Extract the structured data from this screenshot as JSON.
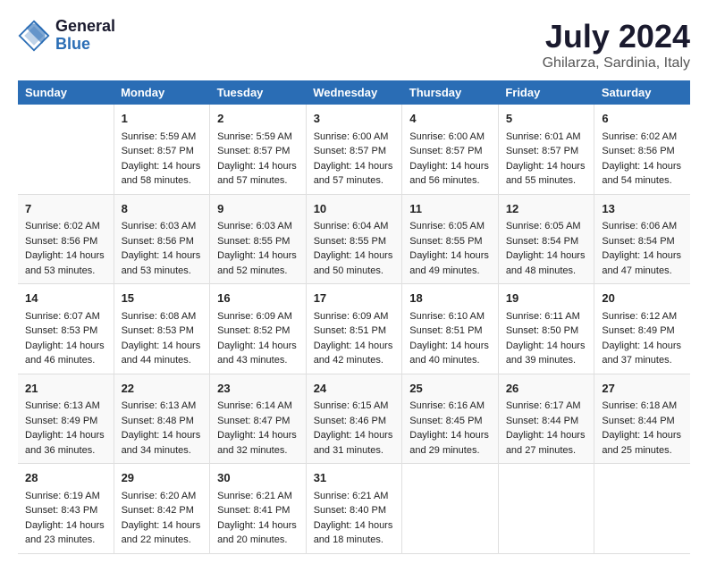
{
  "logo": {
    "general": "General",
    "blue": "Blue"
  },
  "title": "July 2024",
  "subtitle": "Ghilarza, Sardinia, Italy",
  "days_header": [
    "Sunday",
    "Monday",
    "Tuesday",
    "Wednesday",
    "Thursday",
    "Friday",
    "Saturday"
  ],
  "weeks": [
    [
      {
        "day": "",
        "info": ""
      },
      {
        "day": "1",
        "info": "Sunrise: 5:59 AM\nSunset: 8:57 PM\nDaylight: 14 hours\nand 58 minutes."
      },
      {
        "day": "2",
        "info": "Sunrise: 5:59 AM\nSunset: 8:57 PM\nDaylight: 14 hours\nand 57 minutes."
      },
      {
        "day": "3",
        "info": "Sunrise: 6:00 AM\nSunset: 8:57 PM\nDaylight: 14 hours\nand 57 minutes."
      },
      {
        "day": "4",
        "info": "Sunrise: 6:00 AM\nSunset: 8:57 PM\nDaylight: 14 hours\nand 56 minutes."
      },
      {
        "day": "5",
        "info": "Sunrise: 6:01 AM\nSunset: 8:57 PM\nDaylight: 14 hours\nand 55 minutes."
      },
      {
        "day": "6",
        "info": "Sunrise: 6:02 AM\nSunset: 8:56 PM\nDaylight: 14 hours\nand 54 minutes."
      }
    ],
    [
      {
        "day": "7",
        "info": "Sunrise: 6:02 AM\nSunset: 8:56 PM\nDaylight: 14 hours\nand 53 minutes."
      },
      {
        "day": "8",
        "info": "Sunrise: 6:03 AM\nSunset: 8:56 PM\nDaylight: 14 hours\nand 53 minutes."
      },
      {
        "day": "9",
        "info": "Sunrise: 6:03 AM\nSunset: 8:55 PM\nDaylight: 14 hours\nand 52 minutes."
      },
      {
        "day": "10",
        "info": "Sunrise: 6:04 AM\nSunset: 8:55 PM\nDaylight: 14 hours\nand 50 minutes."
      },
      {
        "day": "11",
        "info": "Sunrise: 6:05 AM\nSunset: 8:55 PM\nDaylight: 14 hours\nand 49 minutes."
      },
      {
        "day": "12",
        "info": "Sunrise: 6:05 AM\nSunset: 8:54 PM\nDaylight: 14 hours\nand 48 minutes."
      },
      {
        "day": "13",
        "info": "Sunrise: 6:06 AM\nSunset: 8:54 PM\nDaylight: 14 hours\nand 47 minutes."
      }
    ],
    [
      {
        "day": "14",
        "info": "Sunrise: 6:07 AM\nSunset: 8:53 PM\nDaylight: 14 hours\nand 46 minutes."
      },
      {
        "day": "15",
        "info": "Sunrise: 6:08 AM\nSunset: 8:53 PM\nDaylight: 14 hours\nand 44 minutes."
      },
      {
        "day": "16",
        "info": "Sunrise: 6:09 AM\nSunset: 8:52 PM\nDaylight: 14 hours\nand 43 minutes."
      },
      {
        "day": "17",
        "info": "Sunrise: 6:09 AM\nSunset: 8:51 PM\nDaylight: 14 hours\nand 42 minutes."
      },
      {
        "day": "18",
        "info": "Sunrise: 6:10 AM\nSunset: 8:51 PM\nDaylight: 14 hours\nand 40 minutes."
      },
      {
        "day": "19",
        "info": "Sunrise: 6:11 AM\nSunset: 8:50 PM\nDaylight: 14 hours\nand 39 minutes."
      },
      {
        "day": "20",
        "info": "Sunrise: 6:12 AM\nSunset: 8:49 PM\nDaylight: 14 hours\nand 37 minutes."
      }
    ],
    [
      {
        "day": "21",
        "info": "Sunrise: 6:13 AM\nSunset: 8:49 PM\nDaylight: 14 hours\nand 36 minutes."
      },
      {
        "day": "22",
        "info": "Sunrise: 6:13 AM\nSunset: 8:48 PM\nDaylight: 14 hours\nand 34 minutes."
      },
      {
        "day": "23",
        "info": "Sunrise: 6:14 AM\nSunset: 8:47 PM\nDaylight: 14 hours\nand 32 minutes."
      },
      {
        "day": "24",
        "info": "Sunrise: 6:15 AM\nSunset: 8:46 PM\nDaylight: 14 hours\nand 31 minutes."
      },
      {
        "day": "25",
        "info": "Sunrise: 6:16 AM\nSunset: 8:45 PM\nDaylight: 14 hours\nand 29 minutes."
      },
      {
        "day": "26",
        "info": "Sunrise: 6:17 AM\nSunset: 8:44 PM\nDaylight: 14 hours\nand 27 minutes."
      },
      {
        "day": "27",
        "info": "Sunrise: 6:18 AM\nSunset: 8:44 PM\nDaylight: 14 hours\nand 25 minutes."
      }
    ],
    [
      {
        "day": "28",
        "info": "Sunrise: 6:19 AM\nSunset: 8:43 PM\nDaylight: 14 hours\nand 23 minutes."
      },
      {
        "day": "29",
        "info": "Sunrise: 6:20 AM\nSunset: 8:42 PM\nDaylight: 14 hours\nand 22 minutes."
      },
      {
        "day": "30",
        "info": "Sunrise: 6:21 AM\nSunset: 8:41 PM\nDaylight: 14 hours\nand 20 minutes."
      },
      {
        "day": "31",
        "info": "Sunrise: 6:21 AM\nSunset: 8:40 PM\nDaylight: 14 hours\nand 18 minutes."
      },
      {
        "day": "",
        "info": ""
      },
      {
        "day": "",
        "info": ""
      },
      {
        "day": "",
        "info": ""
      }
    ]
  ]
}
